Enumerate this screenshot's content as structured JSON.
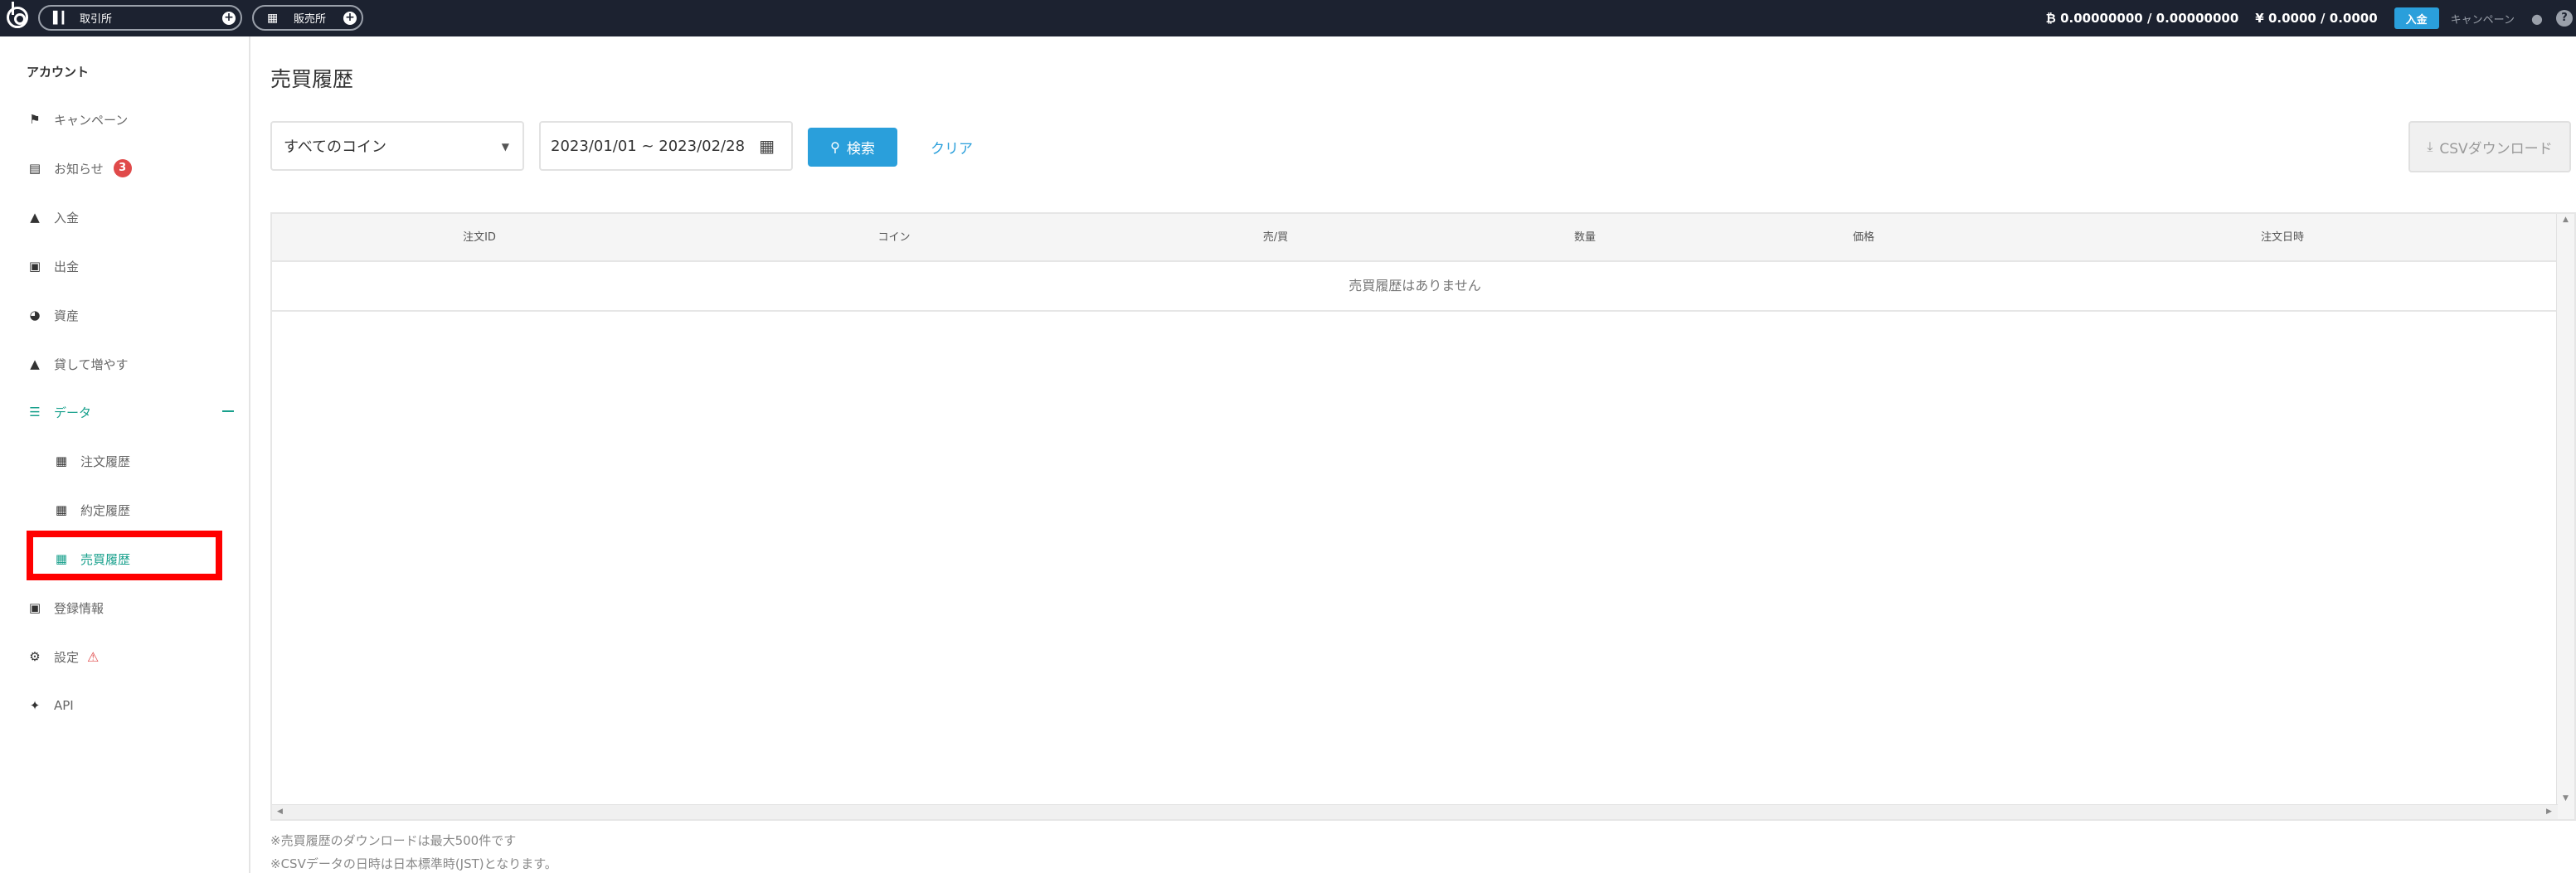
{
  "topbar": {
    "exchange_label": "取引所",
    "store_label": "販売所",
    "btc_balance": "₿ 0.00000000 / 0.00000000",
    "jpy_balance": "¥ 0.0000 / 0.0000",
    "deposit_label": "入金",
    "campaign_label": "キャンペーン"
  },
  "sidebar": {
    "title": "アカウント",
    "items": [
      {
        "label": "キャンペーン",
        "icon": "flag-icon"
      },
      {
        "label": "お知らせ",
        "icon": "message-icon",
        "badge": "3"
      },
      {
        "label": "入金",
        "icon": "bank-icon"
      },
      {
        "label": "出金",
        "icon": "wallet-icon"
      },
      {
        "label": "資産",
        "icon": "pie-chart-icon"
      },
      {
        "label": "貸して増やす",
        "icon": "bank-icon"
      },
      {
        "label": "データ",
        "icon": "database-icon"
      },
      {
        "label": "注文履歴",
        "icon": "clipboard-icon"
      },
      {
        "label": "約定履歴",
        "icon": "clipboard-icon"
      },
      {
        "label": "売買履歴",
        "icon": "clipboard-icon"
      },
      {
        "label": "登録情報",
        "icon": "id-card-icon"
      },
      {
        "label": "設定",
        "icon": "gear-icon"
      },
      {
        "label": "API",
        "icon": "api-icon"
      }
    ]
  },
  "main": {
    "title": "売買履歴",
    "coin_filter": "すべてのコイン",
    "date_range": "2023/01/01 ~ 2023/02/28",
    "search_label": "検索",
    "clear_label": "クリア",
    "csv_label": "CSVダウンロード",
    "table": {
      "columns": [
        "注文ID",
        "コイン",
        "売/買",
        "数量",
        "価格",
        "注文日時"
      ],
      "empty_message": "売買履歴はありません"
    },
    "notes": [
      "※売買履歴のダウンロードは最大500件です",
      "※CSVデータの日時は日本標準時(JST)となります。"
    ]
  }
}
